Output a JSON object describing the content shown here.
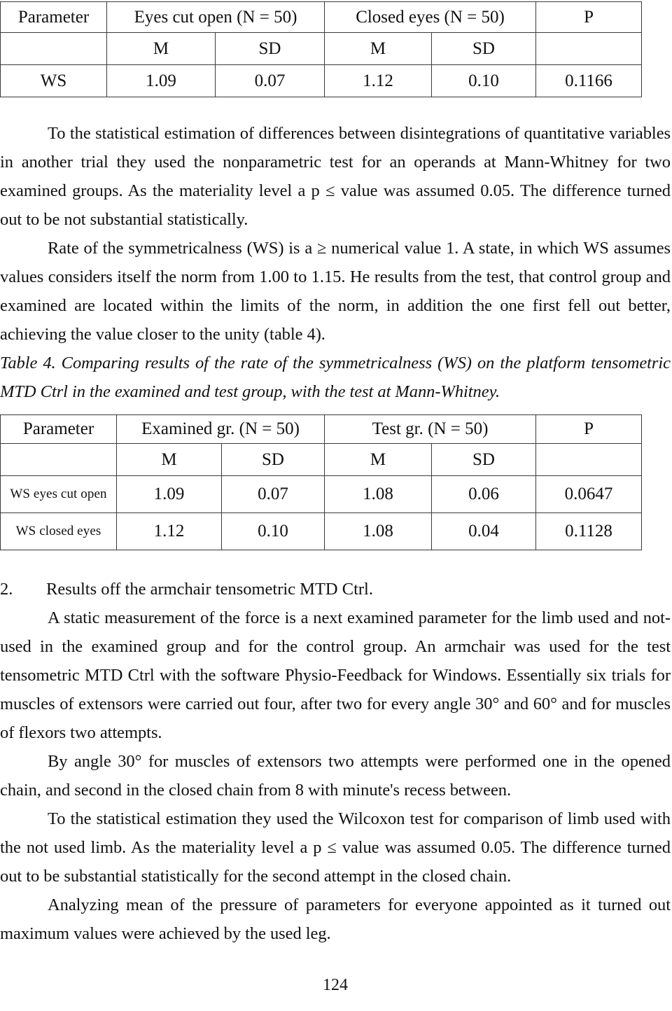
{
  "document": {
    "page_number": "124"
  },
  "table3": {
    "header": {
      "parameter": "Parameter",
      "group1": "Eyes cut open (N = 50)",
      "group2": "Closed eyes (N = 50)",
      "p": "P"
    },
    "subheader": {
      "blank": "",
      "m1": "M",
      "sd1": "SD",
      "m2": "M",
      "sd2": "SD",
      "blank2": ""
    },
    "rows": [
      {
        "label": "WS",
        "m1": "1.09",
        "sd1": "0.07",
        "m2": "1.12",
        "sd2": "0.10",
        "p": "0.1166"
      }
    ]
  },
  "paragraphs": {
    "p1": "To the statistical estimation of differences between disintegrations of quantitative variables in another trial they used the nonparametric test for an operands at Mann-Whitney for two examined groups. As the materiality level a p ≤ value was assumed 0.05. The difference turned out to be not substantial statistically.",
    "p2": "Rate of the symmetricalness (WS) is a ≥ numerical value 1. A state, in which WS assumes values considers itself the norm from 1.00 to 1.15. He results from the test, that control group and examined are located within the limits of the norm, in addition the one first fell out better, achieving the value closer to the unity (table 4).",
    "table4_caption": "Table 4. Comparing results of the rate of the symmetricalness (WS) on the platform tensometric MTD Ctrl in the examined and test group, with the test at Mann-Whitney.",
    "p3": "A static measurement of the force is a next examined parameter for the limb used and not-used in the examined group and for the control group. An armchair was used for the test tensometric MTD Ctrl with the software Physio-Feedback for Windows. Essentially six trials for muscles of extensors were carried out four, after two for every angle 30° and 60° and for muscles of flexors two attempts.",
    "p4": "By angle 30° for muscles of extensors two attempts were performed one in the opened chain, and second in the closed chain from 8 with minute's recess between.",
    "p5": "To the statistical estimation they used the Wilcoxon test for comparison of limb used with the not used limb. As the materiality level a p ≤ value was assumed 0.05. The difference turned out to be substantial statistically for the second attempt in the closed chain.",
    "p6": "Analyzing mean of the pressure of parameters for everyone appointed as it turned out maximum values were achieved by the used leg."
  },
  "section_heading": {
    "number": "2.",
    "text": "Results off the armchair tensometric MTD Ctrl."
  },
  "table4": {
    "header": {
      "parameter": "Parameter",
      "group1": "Examined gr. (N = 50)",
      "group2": "Test gr. (N = 50)",
      "p": "P"
    },
    "subheader": {
      "blank": "",
      "m1": "M",
      "sd1": "SD",
      "m2": "M",
      "sd2": "SD",
      "blank2": ""
    },
    "rows": [
      {
        "label": "WS eyes cut open",
        "m1": "1.09",
        "sd1": "0.07",
        "m2": "1.08",
        "sd2": "0.06",
        "p": "0.0647"
      },
      {
        "label": "WS closed eyes",
        "m1": "1.12",
        "sd1": "0.10",
        "m2": "1.08",
        "sd2": "0.04",
        "p": "0.1128"
      }
    ]
  }
}
